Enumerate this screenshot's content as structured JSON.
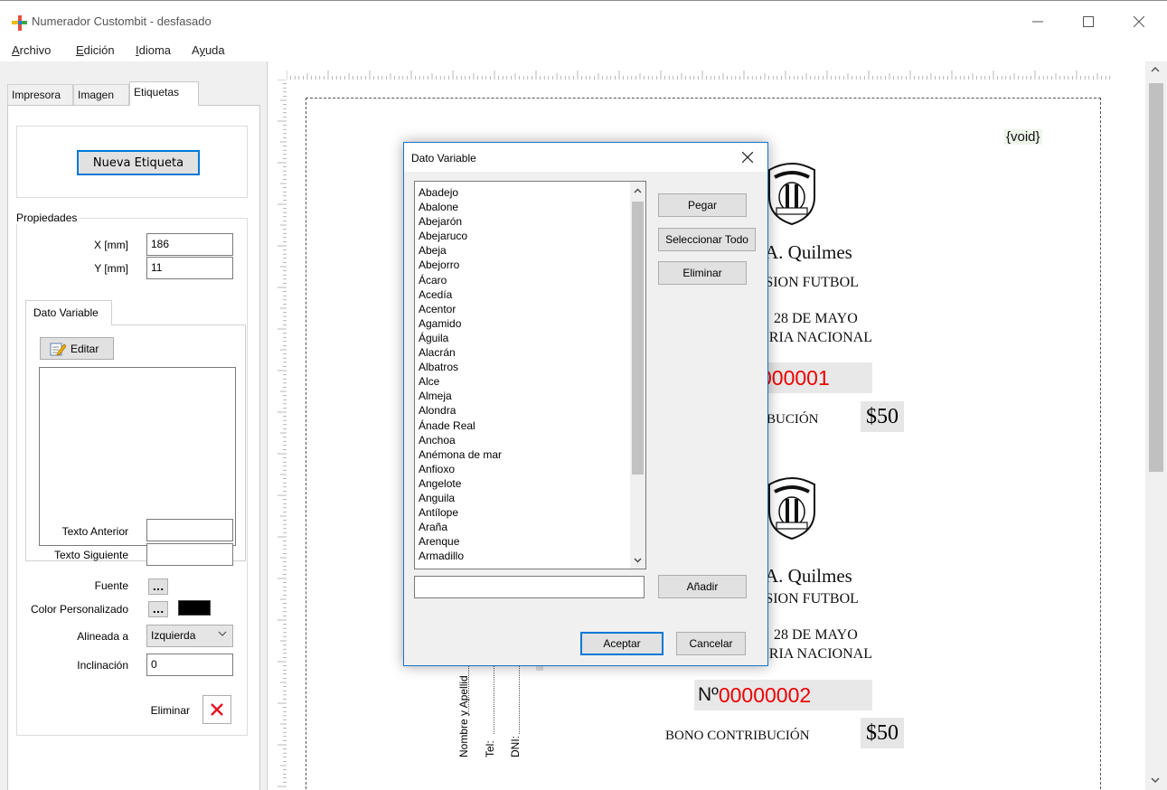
{
  "window": {
    "title": "Numerador Custombit - desfasado",
    "minimize_glyph": "—",
    "maximize_glyph": "☐",
    "close_glyph": "✕"
  },
  "menu": {
    "items": [
      {
        "accel": "A",
        "rest": "rchivo"
      },
      {
        "accel": "E",
        "rest": "dición"
      },
      {
        "accel": "I",
        "rest": "dioma"
      },
      {
        "pre": "A",
        "accel": "y",
        "rest": "uda"
      }
    ]
  },
  "left_panel": {
    "tabs": [
      "Impresora",
      "Imagen",
      "Etiquetas"
    ],
    "active_tab": "Etiquetas",
    "new_label_button": "Nueva Etiqueta",
    "properties_legend": "Propiedades",
    "x_label": "X [mm]",
    "x_value": "186",
    "y_label": "Y [mm]",
    "y_value": "11",
    "variable_tab": "Dato Variable",
    "edit_button": "Editar",
    "prev_text_label": "Texto Anterior",
    "next_text_label": "Texto Siguiente",
    "font_label": "Fuente",
    "custom_color_label": "Color Personalizado",
    "align_label": "Alineada a",
    "align_value": "Izquierda",
    "slant_label": "Inclinación",
    "slant_value": "0",
    "delete_label": "Eliminar",
    "ellipsis": "...",
    "custom_color": "#000000"
  },
  "document": {
    "void_tag": "{void}",
    "tickets": [
      {
        "club": "A. Quilmes",
        "division": "ISION FUTBOL",
        "date": "28 DE MAYO",
        "lottery": "ERIA NACIONAL",
        "number": "000001",
        "bono": "RIBUCIÓN",
        "price": "$50"
      },
      {
        "club": "A. Quilmes",
        "division": "ISION FUTBOL",
        "date": "28 DE MAYO",
        "lottery": "ERIA NACIONAL",
        "number_prefix": "Nº ",
        "number": "00000002",
        "bono": "BONO CONTRIBUCIÓN",
        "price": "$50"
      }
    ],
    "stub_name": "Nombre y Apellid",
    "stub_tel": "Tel:",
    "stub_dni": "DNI:",
    "number_color": "#ee0000"
  },
  "dialog": {
    "title": "Dato Variable",
    "items": [
      "Abadejo",
      "Abalone",
      "Abejarón",
      "Abejaruco",
      "Abeja",
      "Abejorro",
      "Ácaro",
      "Acedía",
      "Acentor",
      "Agamido",
      "Águila",
      "Alacrán",
      "Albatros",
      "Alce",
      "Almeja",
      "Alondra",
      "Ánade Real",
      "Anchoa",
      "Anémona de mar",
      "Anfioxo",
      "Angelote",
      "Anguila",
      "Antílope",
      "Araña",
      "Arenque",
      "Armadillo"
    ],
    "paste_button": "Pegar",
    "select_all_button": "Seleccionar Todo",
    "delete_button": "Eliminar",
    "add_button": "Añadir",
    "add_input_value": "",
    "ok_button": "Aceptar",
    "cancel_button": "Cancelar"
  }
}
